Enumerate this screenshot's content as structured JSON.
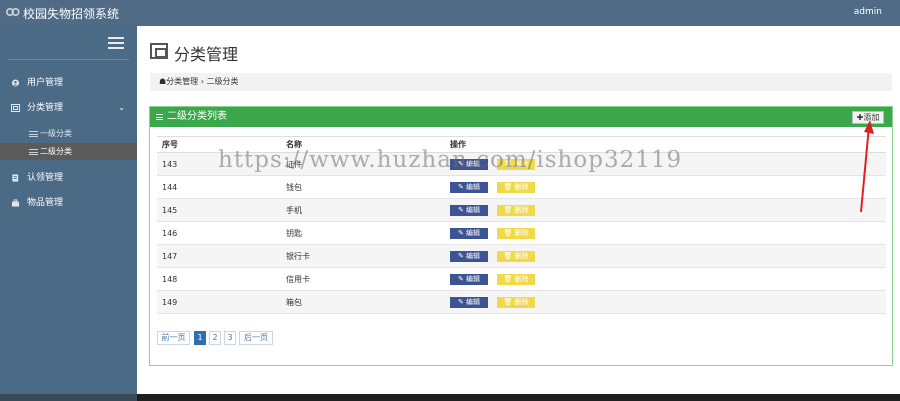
{
  "header": {
    "app_title": "校园失物招领系统",
    "user": "admin"
  },
  "sidebar": {
    "items": [
      {
        "label": "用户管理",
        "icon": "user-icon"
      },
      {
        "label": "分类管理",
        "icon": "category-icon",
        "expanded": true,
        "children": [
          {
            "label": "一级分类"
          },
          {
            "label": "二级分类",
            "active": true
          }
        ]
      },
      {
        "label": "认领管理",
        "icon": "claim-icon"
      },
      {
        "label": "物品管理",
        "icon": "items-icon"
      }
    ]
  },
  "page": {
    "title": "分类管理",
    "breadcrumb": "☗分类管理 › 二级分类"
  },
  "panel": {
    "title": "二级分类列表",
    "add_label": "✚添加",
    "columns": [
      "序号",
      "名称",
      "操作"
    ],
    "edit_label": "✎ 编辑",
    "delete_label": "🗑 删除",
    "rows": [
      {
        "id": "143",
        "name": "证件"
      },
      {
        "id": "144",
        "name": "钱包"
      },
      {
        "id": "145",
        "name": "手机"
      },
      {
        "id": "146",
        "name": "钥匙"
      },
      {
        "id": "147",
        "name": "银行卡"
      },
      {
        "id": "148",
        "name": "信用卡"
      },
      {
        "id": "149",
        "name": "箱包"
      }
    ]
  },
  "pagination": {
    "prev": "前一页",
    "pages": [
      "1",
      "2",
      "3"
    ],
    "current": "1",
    "next": "后一页"
  },
  "watermark": "https://www.huzhan.com/ishop32119",
  "colors": {
    "topbar": "#4f6b86",
    "sidebar": "#4a6a86",
    "panel_header": "#3aa84a",
    "edit_button": "#3d5494",
    "delete_button": "#f0d94a",
    "annotation_arrow": "#e02020"
  }
}
